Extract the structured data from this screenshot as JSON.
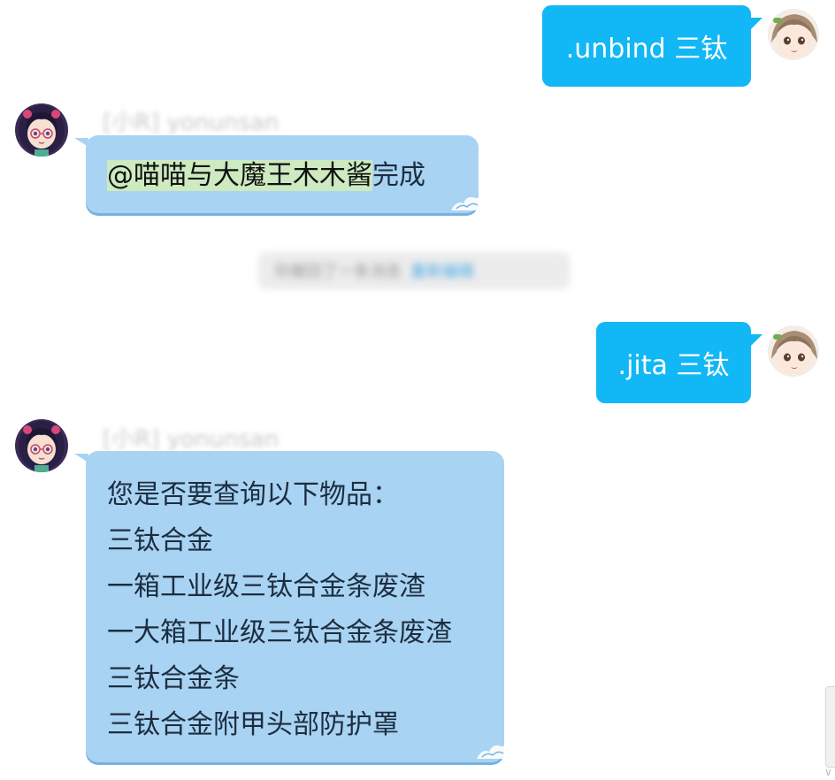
{
  "messages": [
    {
      "direction": "outgoing",
      "text": ".unbind 三钛"
    },
    {
      "direction": "incoming",
      "sender": "[小R] yonunsan",
      "mention": "@喵喵与大魔王木木酱",
      "text": "完成"
    },
    {
      "direction": "system",
      "text": "你撤回了一条消息",
      "link": "重新编辑"
    },
    {
      "direction": "outgoing",
      "text": ".jita 三钛"
    },
    {
      "direction": "incoming",
      "sender": "[小R] yonunsan",
      "lines": [
        "您是否要查询以下物品：",
        "三钛合金",
        "一箱工业级三钛合金条废渣",
        "一大箱工业级三钛合金条废渣",
        "三钛合金条",
        "三钛合金附甲头部防护罩"
      ]
    }
  ],
  "icons": {
    "self_avatar": "anime-girl-avatar-icon",
    "bot_avatar": "anime-girl-glasses-avatar-icon",
    "bubble_corner": "wave-decoration-icon",
    "scroll_down": "chevron-down-icon"
  },
  "colors": {
    "outgoing_bubble": "#12b7f5",
    "incoming_bubble": "#a9d3f2",
    "mention_highlight": "#cdeac0",
    "incoming_text": "#1c2d40"
  }
}
